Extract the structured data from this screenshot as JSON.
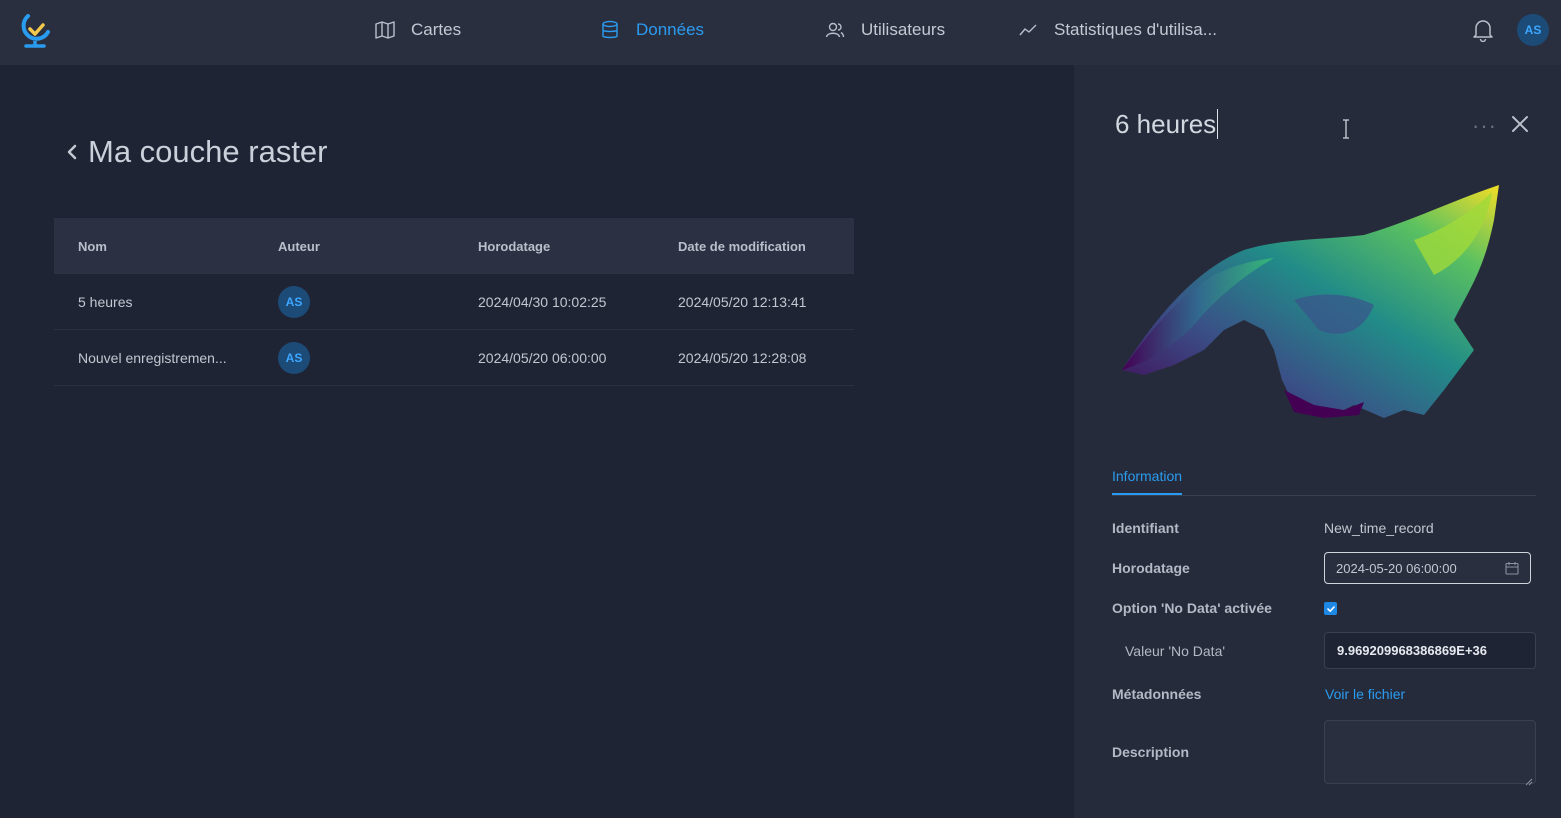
{
  "nav": {
    "items": [
      {
        "label": "Cartes",
        "icon": "map-icon"
      },
      {
        "label": "Données",
        "icon": "database-icon"
      },
      {
        "label": "Utilisateurs",
        "icon": "users-icon"
      },
      {
        "label": "Statistiques d'utilisa...",
        "icon": "chart-line-icon"
      }
    ],
    "active": "Données",
    "user_initials": "AS"
  },
  "colors": {
    "background": "#1f2434",
    "topbar": "#2a2f40",
    "panel": "#262b3b",
    "accent": "#2a9cf0",
    "avatar_bg": "#1c4b78"
  },
  "page": {
    "title": "Ma couche raster"
  },
  "table": {
    "headers": [
      "Nom",
      "Auteur",
      "Horodatage",
      "Date de modification"
    ],
    "rows": [
      {
        "name": "5 heures",
        "author": "AS",
        "timestamp": "2024/04/30 10:02:25",
        "modified": "2024/05/20 12:13:41"
      },
      {
        "name": "Nouvel enregistremen...",
        "author": "AS",
        "timestamp": "2024/05/20 06:00:00",
        "modified": "2024/05/20 12:28:08"
      }
    ]
  },
  "panel": {
    "title": "6 heures",
    "tab": "Information",
    "fields": {
      "identifier_label": "Identifiant",
      "identifier_value": "New_time_record",
      "timestamp_label": "Horodatage",
      "timestamp_value": "2024-05-20 06:00:00",
      "nodata_option_label": "Option 'No Data' activée",
      "nodata_option_checked": true,
      "nodata_value_label": "Valeur 'No Data'",
      "nodata_value": "9.969209968386869E+36",
      "metadata_label": "Métadonnées",
      "metadata_link": "Voir le fichier",
      "description_label": "Description",
      "description_value": ""
    }
  }
}
